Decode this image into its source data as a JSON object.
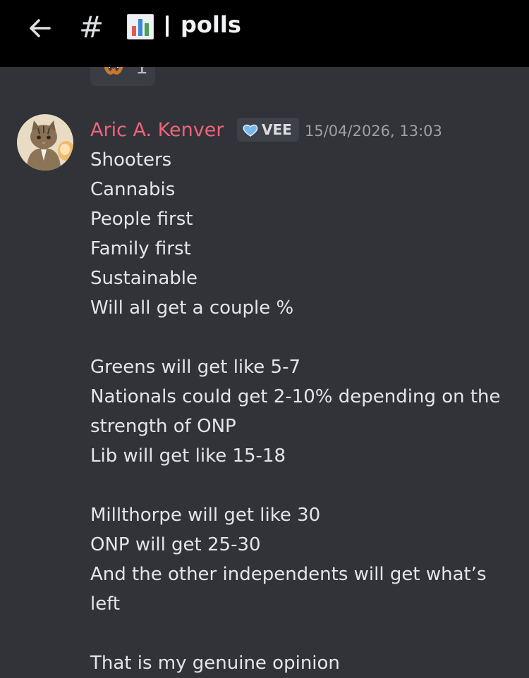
{
  "header": {
    "hash": "#",
    "chart_emoji": "bar-chart-emoji",
    "channel_name": "polls"
  },
  "reaction": {
    "emoji": "pretzel-emoji",
    "count": "1"
  },
  "message": {
    "author": "Aric A. Kenver",
    "author_color": "#f0637a",
    "role_tag": "VEE",
    "role_icon": "blue-heart-icon",
    "timestamp": "15/04/2026, 13:03",
    "lines": [
      "Shooters",
      "Cannabis",
      "People first",
      "Family first",
      "Sustainable",
      "Will all get a couple %",
      "",
      "Greens will get like 5-7",
      "Nationals could get 2-10% depending on the",
      "strength of ONP",
      "Lib will get like 15-18",
      "",
      "Millthorpe will get like 30",
      "ONP will get 25-30",
      "And the other independents will get what’s",
      "left",
      "",
      "That is my genuine opinion"
    ]
  },
  "colors": {
    "background": "#313338",
    "header_background": "#000000",
    "text": "#e3e5e8",
    "muted": "#9da1a8"
  }
}
